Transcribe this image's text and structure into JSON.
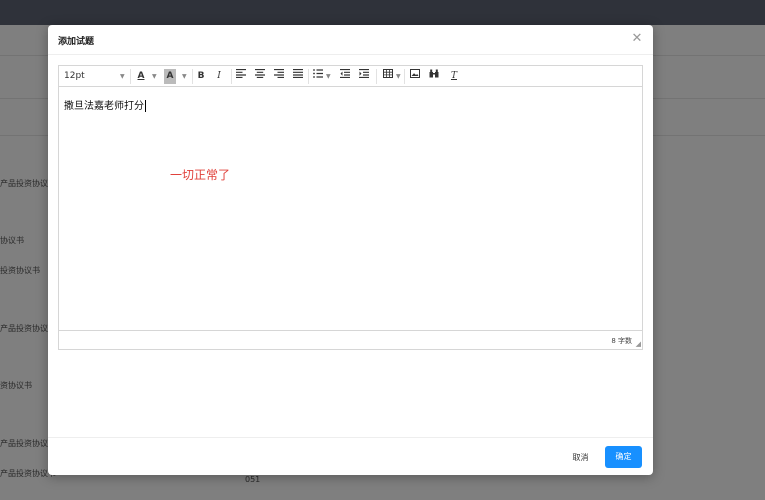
{
  "background": {
    "row_texts": [
      "产品投资协议书",
      "协议书",
      "投资协议书",
      "产品投资协议书",
      "资协议书",
      "产品投资协议书",
      "产品投资协议书"
    ],
    "bottom_text": "051"
  },
  "dialog": {
    "title": "添加试题",
    "close_icon": "close-icon",
    "toolbar": {
      "font_size": "12pt",
      "text_color_label": "A",
      "bg_color_label": "A",
      "bold_label": "B",
      "italic_label": "I",
      "clear_format_label": "T",
      "icons": [
        "text-color-icon",
        "background-color-icon",
        "bold-icon",
        "italic-icon",
        "align-left-icon",
        "align-center-icon",
        "align-right-icon",
        "justify-icon",
        "numbered-list-icon",
        "outdent-icon",
        "indent-icon",
        "table-icon",
        "image-icon",
        "find-icon",
        "clear-format-icon"
      ]
    },
    "content": "撒旦法嘉老师打分",
    "word_count": "8 字数",
    "cancel_label": "取消",
    "ok_label": "确定",
    "ok_color": "#1890ff"
  },
  "annotation": {
    "text": "一切正常了",
    "color": "#e0403a"
  }
}
